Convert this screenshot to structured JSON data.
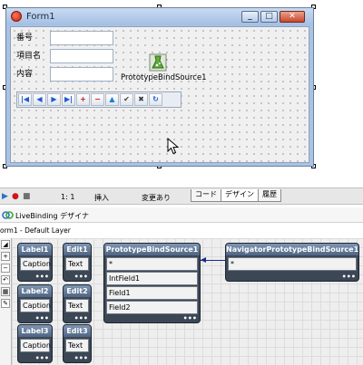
{
  "form": {
    "title": "Form1",
    "labels": [
      "番号",
      "項目名",
      "内容"
    ],
    "component_label": "PrototypeBindSource1",
    "nav_buttons": [
      {
        "name": "first",
        "glyph": "|◀"
      },
      {
        "name": "prior",
        "glyph": "◀"
      },
      {
        "name": "next",
        "glyph": "▶"
      },
      {
        "name": "last",
        "glyph": "▶|"
      },
      {
        "name": "insert",
        "glyph": "+"
      },
      {
        "name": "delete",
        "glyph": "−"
      },
      {
        "name": "edit",
        "glyph": "▲"
      },
      {
        "name": "post",
        "glyph": "✔"
      },
      {
        "name": "cancel",
        "glyph": "✖"
      },
      {
        "name": "refresh",
        "glyph": "↻"
      }
    ]
  },
  "statusbar": {
    "position": "1:  1",
    "mode": "挿入",
    "modified": "変更あり",
    "tabs": [
      "コード",
      "デザイン",
      "履歴"
    ],
    "active_tab": "デザイン"
  },
  "livebinding": {
    "title": "LiveBinding デザイナ",
    "layer": "orm1 - Default Layer",
    "nodes": [
      {
        "title": "Label1",
        "fields": [
          "Caption"
        ]
      },
      {
        "title": "Edit1",
        "fields": [
          "Text"
        ]
      },
      {
        "title": "Label2",
        "fields": [
          "Caption"
        ]
      },
      {
        "title": "Edit2",
        "fields": [
          "Text"
        ]
      },
      {
        "title": "Label3",
        "fields": [
          "Caption"
        ]
      },
      {
        "title": "Edit3",
        "fields": [
          "Text"
        ]
      },
      {
        "title": "PrototypeBindSource1",
        "fields": [
          "*",
          "IntField1",
          "Field1",
          "Field2"
        ]
      },
      {
        "title": "NavigatorPrototypeBindSource1",
        "fields": [
          "*"
        ]
      }
    ],
    "more": "•••"
  },
  "colors": {
    "node_header": "#5a7190",
    "node_body": "#3c4756",
    "link": "#1a2a8a"
  }
}
